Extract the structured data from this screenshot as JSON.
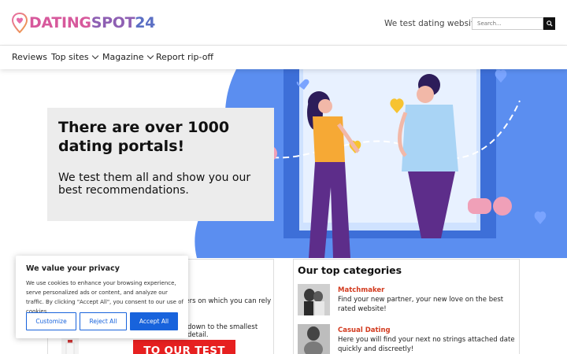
{
  "logo": {
    "part1": "DATING",
    "part2": "SPOT",
    "part3": "24"
  },
  "header": {
    "tagline": "We test dating websites"
  },
  "search": {
    "placeholder": "Search..."
  },
  "nav": {
    "items": [
      {
        "label": "Reviews"
      },
      {
        "label": "Top sites"
      },
      {
        "label": "Magazine"
      },
      {
        "label": "Report rip-off"
      }
    ]
  },
  "hero": {
    "title": "There are over 1000 dating portals!",
    "subtitle": "We test them all and show you our best recommendations."
  },
  "left_card": {
    "text1": "ners on which you can rely",
    "text2": "down to the smallest detail.",
    "button": "TO OUR TEST"
  },
  "categories": {
    "title": "Our top categories",
    "items": [
      {
        "name": "Matchmaker",
        "desc": "Find your new partner, your new love on the best rated website!"
      },
      {
        "name": "Casual Dating",
        "desc": "Here you will find your next no strings attached date quickly and discreetly!"
      }
    ]
  },
  "cookie": {
    "title": "We value your privacy",
    "text": "We use cookies to enhance your browsing experience, serve personalized ads or content, and analyze our traffic. By clicking \"Accept All\", you consent to our use of cookies.",
    "customize": "Customize",
    "reject": "Reject All",
    "accept": "Accept All"
  },
  "colors": {
    "accent_red": "#e62020",
    "cookie_blue": "#1863dc",
    "hero_blue": "#5b8ef0"
  }
}
